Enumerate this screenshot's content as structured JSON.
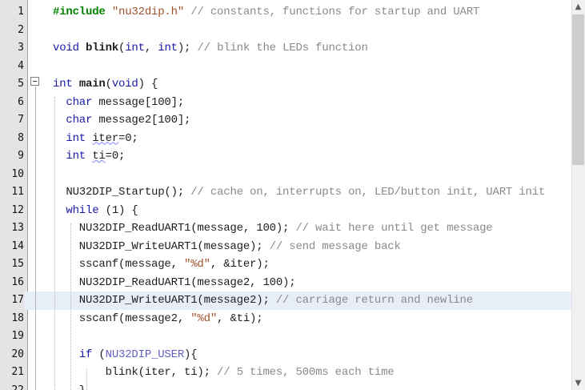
{
  "editor": {
    "lines": [
      {
        "num": "1",
        "segs": [
          {
            "t": "#include ",
            "c": "pp"
          },
          {
            "t": "\"nu32dip.h\"",
            "c": "str"
          },
          {
            "t": " // constants, functions for startup and UART",
            "c": "cm"
          }
        ]
      },
      {
        "num": "2",
        "segs": []
      },
      {
        "num": "3",
        "segs": [
          {
            "t": "void ",
            "c": "kw"
          },
          {
            "t": "blink",
            "c": "bold"
          },
          {
            "t": "(",
            "c": ""
          },
          {
            "t": "int",
            "c": "kw"
          },
          {
            "t": ", ",
            "c": ""
          },
          {
            "t": "int",
            "c": "kw"
          },
          {
            "t": "); ",
            "c": ""
          },
          {
            "t": "// blink the LEDs function",
            "c": "cm"
          }
        ]
      },
      {
        "num": "4",
        "segs": []
      },
      {
        "num": "5",
        "segs": [
          {
            "t": "int ",
            "c": "kw"
          },
          {
            "t": "main",
            "c": "bold"
          },
          {
            "t": "(",
            "c": ""
          },
          {
            "t": "void",
            "c": "kw"
          },
          {
            "t": ") {",
            "c": ""
          }
        ]
      },
      {
        "num": "6",
        "segs": [
          {
            "t": "  ",
            "c": ""
          },
          {
            "t": "char ",
            "c": "kw"
          },
          {
            "t": "message[100];",
            "c": ""
          }
        ]
      },
      {
        "num": "7",
        "segs": [
          {
            "t": "  ",
            "c": ""
          },
          {
            "t": "char ",
            "c": "kw"
          },
          {
            "t": "message2[100];",
            "c": ""
          }
        ]
      },
      {
        "num": "8",
        "segs": [
          {
            "t": "  ",
            "c": ""
          },
          {
            "t": "int ",
            "c": "kw"
          },
          {
            "t": "iter",
            "c": "squig"
          },
          {
            "t": "=0;",
            "c": ""
          }
        ]
      },
      {
        "num": "9",
        "segs": [
          {
            "t": "  ",
            "c": ""
          },
          {
            "t": "int ",
            "c": "kw"
          },
          {
            "t": "ti",
            "c": "squig"
          },
          {
            "t": "=0;",
            "c": ""
          }
        ]
      },
      {
        "num": "10",
        "segs": []
      },
      {
        "num": "11",
        "segs": [
          {
            "t": "  NU32DIP_Startup(); ",
            "c": ""
          },
          {
            "t": "// cache on, interrupts on, LED/button init, UART init",
            "c": "cm"
          }
        ]
      },
      {
        "num": "12",
        "segs": [
          {
            "t": "  ",
            "c": ""
          },
          {
            "t": "while ",
            "c": "kw"
          },
          {
            "t": "(1) {",
            "c": ""
          }
        ]
      },
      {
        "num": "13",
        "segs": [
          {
            "t": "    NU32DIP_ReadUART1(message, 100); ",
            "c": ""
          },
          {
            "t": "// wait here until get message",
            "c": "cm"
          }
        ]
      },
      {
        "num": "14",
        "segs": [
          {
            "t": "    NU32DIP_WriteUART1(message); ",
            "c": ""
          },
          {
            "t": "// send message back",
            "c": "cm"
          }
        ]
      },
      {
        "num": "15",
        "segs": [
          {
            "t": "    sscanf(message, ",
            "c": ""
          },
          {
            "t": "\"%d\"",
            "c": "str"
          },
          {
            "t": ", &iter);",
            "c": ""
          }
        ]
      },
      {
        "num": "16",
        "segs": [
          {
            "t": "    NU32DIP_ReadUART1(message2, 100);",
            "c": ""
          }
        ]
      },
      {
        "num": "17",
        "segs": [
          {
            "t": "    NU32DIP_WriteUART1(message2); ",
            "c": ""
          },
          {
            "t": "// carriage return and newline",
            "c": "cm"
          }
        ],
        "hl": true
      },
      {
        "num": "18",
        "segs": [
          {
            "t": "    sscanf(message2, ",
            "c": ""
          },
          {
            "t": "\"%d\"",
            "c": "str"
          },
          {
            "t": ", &ti);",
            "c": ""
          }
        ]
      },
      {
        "num": "19",
        "segs": []
      },
      {
        "num": "20",
        "segs": [
          {
            "t": "    ",
            "c": ""
          },
          {
            "t": "if ",
            "c": "kw"
          },
          {
            "t": "(",
            "c": ""
          },
          {
            "t": "NU32DIP_USER",
            "c": "macro"
          },
          {
            "t": "){",
            "c": ""
          }
        ]
      },
      {
        "num": "21",
        "segs": [
          {
            "t": "        blink(iter, ti); ",
            "c": ""
          },
          {
            "t": "// 5 times, 500ms each time",
            "c": "cm"
          }
        ]
      },
      {
        "num": "22",
        "segs": [
          {
            "t": "    }",
            "c": ""
          }
        ]
      }
    ]
  },
  "scrollbar": {
    "up_icon": "▲",
    "down_icon": "▼"
  }
}
